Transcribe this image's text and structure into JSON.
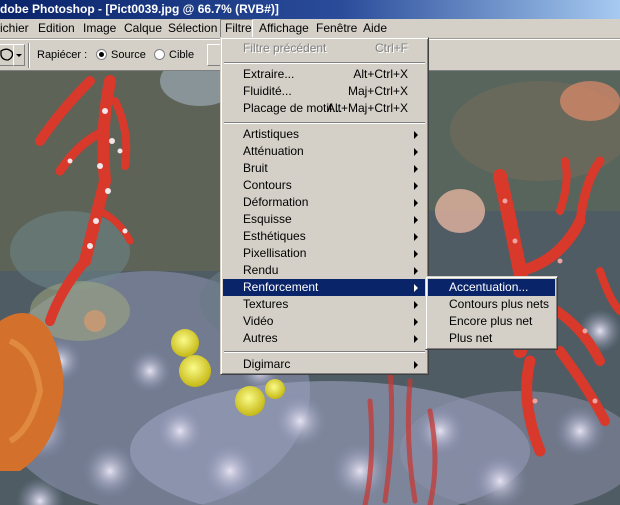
{
  "window": {
    "title": "dobe Photoshop - [Pict0039.jpg @ 66.7% (RVB#)]"
  },
  "menubar": {
    "items": [
      "ichier",
      "Edition",
      "Image",
      "Calque",
      "Sélection",
      "Filtre",
      "Affichage",
      "Fenêtre",
      "Aide"
    ],
    "active": "Filtre"
  },
  "options": {
    "rapiecer_label": "Rapiécer :",
    "source_label": "Source",
    "source_checked": true,
    "cible_label": "Cible",
    "cible_checked": false
  },
  "filter_menu": {
    "last_filter": {
      "label": "Filtre précédent",
      "shortcut": "Ctrl+F",
      "enabled": false
    },
    "group1": [
      {
        "label": "Extraire...",
        "shortcut": "Alt+Ctrl+X"
      },
      {
        "label": "Fluidité...",
        "shortcut": "Maj+Ctrl+X"
      },
      {
        "label": "Placage de motif...",
        "shortcut": "Alt+Maj+Ctrl+X"
      }
    ],
    "group2": [
      {
        "label": "Artistiques"
      },
      {
        "label": "Atténuation"
      },
      {
        "label": "Bruit"
      },
      {
        "label": "Contours"
      },
      {
        "label": "Déformation"
      },
      {
        "label": "Esquisse"
      },
      {
        "label": "Esthétiques"
      },
      {
        "label": "Pixellisation"
      },
      {
        "label": "Rendu"
      },
      {
        "label": "Renforcement",
        "highlighted": true
      },
      {
        "label": "Textures"
      },
      {
        "label": "Vidéo"
      },
      {
        "label": "Autres"
      }
    ],
    "group3": [
      {
        "label": "Digimarc"
      }
    ]
  },
  "submenu": {
    "parent": "Renforcement",
    "items": [
      {
        "label": "Accentuation...",
        "highlighted": true
      },
      {
        "label": "Contours plus nets"
      },
      {
        "label": "Encore plus net"
      },
      {
        "label": "Plus net"
      }
    ]
  },
  "colors": {
    "menu_highlight": "#0a246a",
    "menu_face": "#d4d0c8",
    "coral_red": "#d8392a"
  }
}
